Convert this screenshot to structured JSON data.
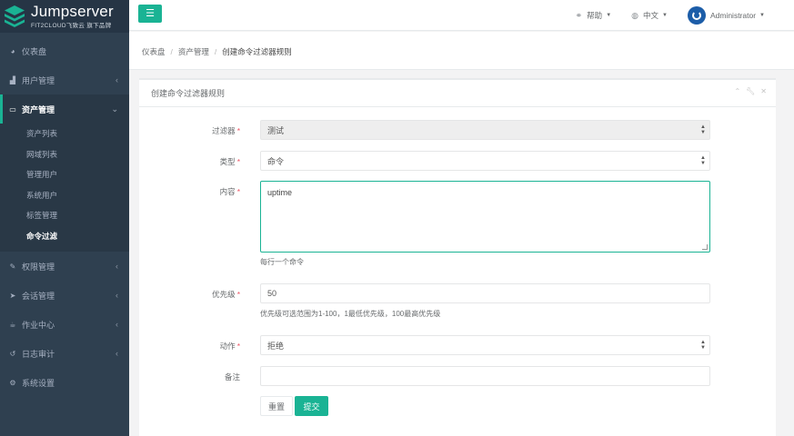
{
  "brand": {
    "title": "Jumpserver",
    "subtitle": "FIT2CLOUD飞致云 旗下品牌"
  },
  "sidebar": {
    "items": [
      {
        "label": "仪表盘",
        "icon": "dashboard-icon"
      },
      {
        "label": "用户管理",
        "icon": "users-icon"
      },
      {
        "label": "资产管理",
        "icon": "inbox-icon"
      },
      {
        "label": "权限管理",
        "icon": "edit-icon"
      },
      {
        "label": "会话管理",
        "icon": "paper-plane-icon"
      },
      {
        "label": "作业中心",
        "icon": "coffee-icon"
      },
      {
        "label": "日志审计",
        "icon": "history-icon"
      },
      {
        "label": "系统设置",
        "icon": "gears-icon"
      }
    ],
    "sub_items": [
      "资产列表",
      "网域列表",
      "管理用户",
      "系统用户",
      "标签管理",
      "命令过滤"
    ]
  },
  "topbar": {
    "help": "帮助",
    "lang": "中文",
    "user": "Administrator"
  },
  "breadcrumb": {
    "level1": "仪表盘",
    "level2": "资产管理",
    "level3": "创建命令过滤器规则"
  },
  "panel": {
    "title": "创建命令过滤器规则"
  },
  "form": {
    "filter": {
      "label": "过滤器",
      "value": "测试"
    },
    "type": {
      "label": "类型",
      "value": "命令"
    },
    "content": {
      "label": "内容",
      "value": "uptime",
      "help": "每行一个命令"
    },
    "priority": {
      "label": "优先级",
      "value": "50",
      "help": "优先级可选范围为1-100，1最低优先级，100最高优先级"
    },
    "action": {
      "label": "动作",
      "value": "拒绝"
    },
    "comment": {
      "label": "备注",
      "value": ""
    },
    "required_mark": "*",
    "reset_label": "重置",
    "submit_label": "提交"
  },
  "colors": {
    "accent": "#1ab394",
    "sidebar": "#2f4050",
    "required": "#ed5565"
  }
}
